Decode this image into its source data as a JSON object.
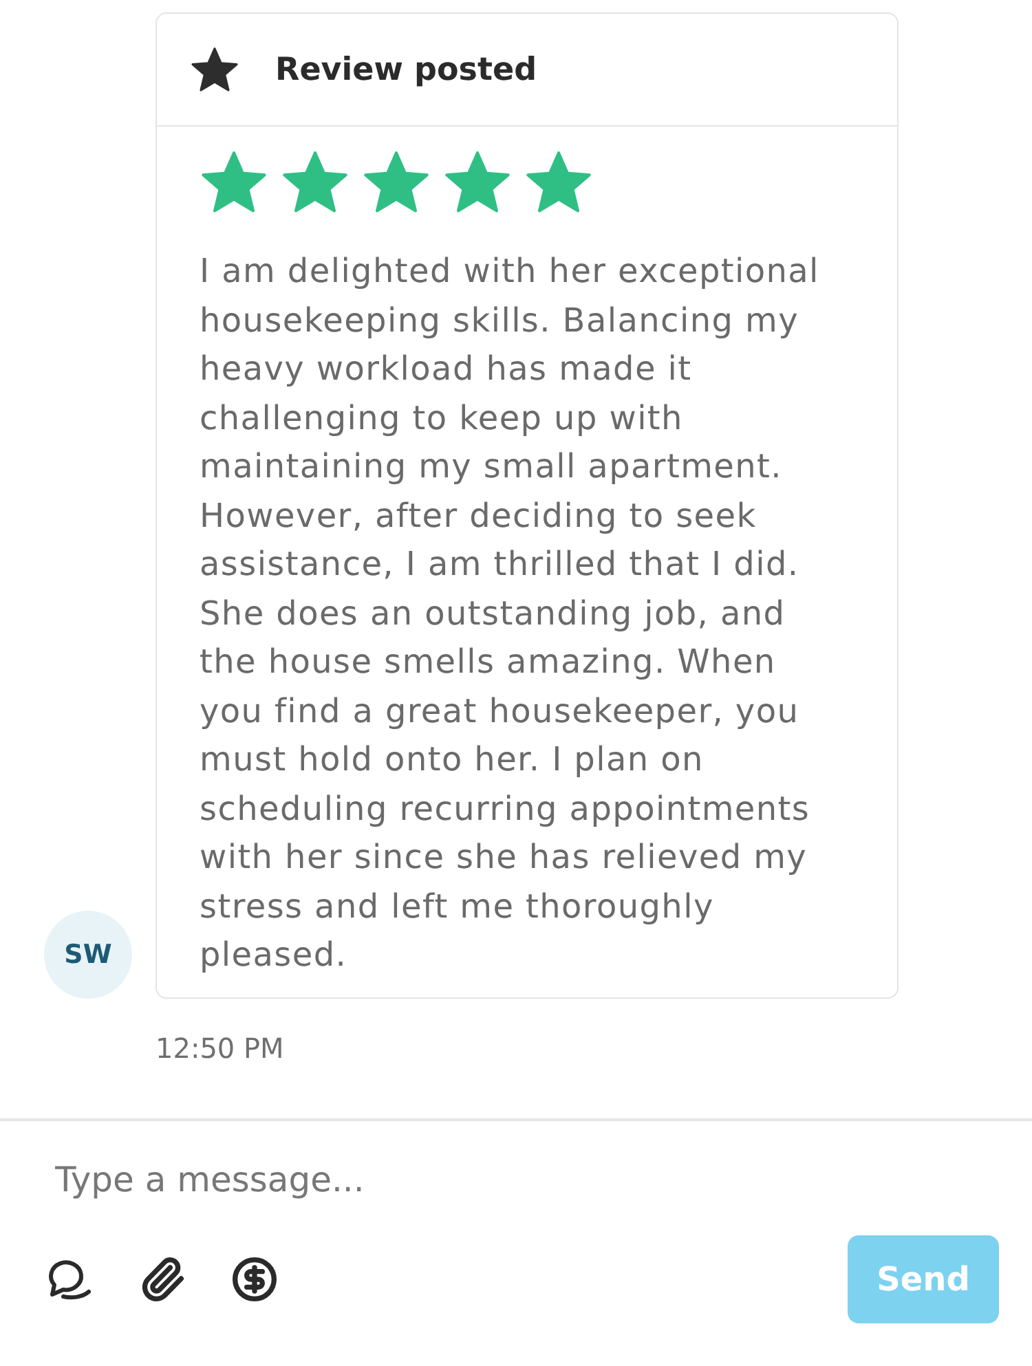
{
  "review_card": {
    "title": "Review posted",
    "stars": 5,
    "text": "I am delighted with her exceptional housekeeping skills. Balancing my heavy workload has made it challenging to keep up with maintaining my small apartment. However, after deciding to seek assistance, I am thrilled that I did. She does an outstanding job, and the house smells amazing. When you find a great housekeeper, you must hold onto her. I plan on scheduling recurring appointments with her since she has relieved my stress and left me thoroughly pleased."
  },
  "avatar": {
    "initials": "SW"
  },
  "timestamp": "12:50 PM",
  "composer": {
    "placeholder": "Type a message...",
    "send_label": "Send",
    "send_disabled": true
  }
}
